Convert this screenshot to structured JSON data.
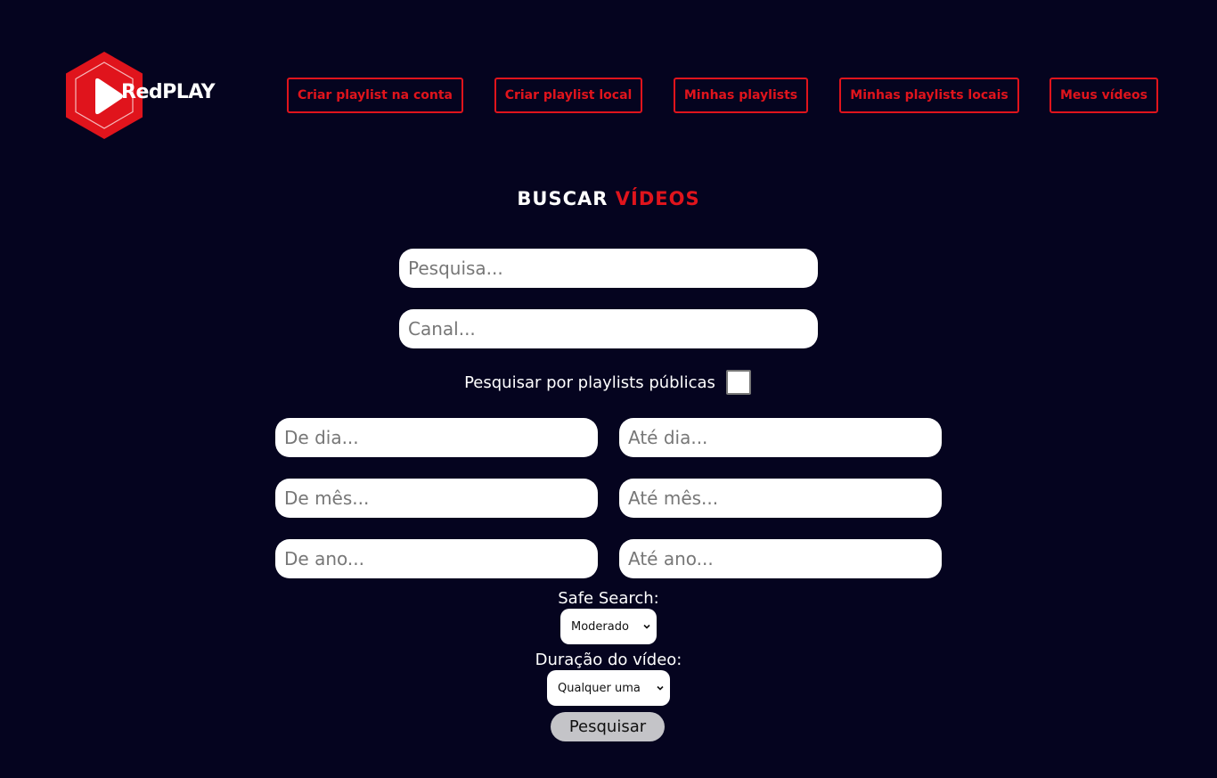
{
  "header": {
    "logo_text": "RedPLAY",
    "nav": [
      {
        "label": "Criar playlist na conta"
      },
      {
        "label": "Criar playlist local"
      },
      {
        "label": "Minhas playlists"
      },
      {
        "label": "Minhas playlists locais"
      },
      {
        "label": "Meus vídeos"
      }
    ]
  },
  "main": {
    "title_part1": "BUSCAR",
    "title_part2": "VÍDEOS",
    "search_placeholder": "Pesquisa...",
    "channel_placeholder": "Canal...",
    "public_playlists_label": "Pesquisar por playlists públicas",
    "public_playlists_checked": false,
    "from_day_placeholder": "De dia...",
    "to_day_placeholder": "Até dia...",
    "from_month_placeholder": "De mês...",
    "to_month_placeholder": "Até mês...",
    "from_year_placeholder": "De ano...",
    "to_year_placeholder": "Até ano...",
    "safe_search_label": "Safe Search:",
    "safe_search_value": "Moderado",
    "duration_label": "Duração do vídeo:",
    "duration_value": "Qualquer uma",
    "submit_label": "Pesquisar"
  },
  "colors": {
    "background": "#05041f",
    "accent": "#e0141c"
  },
  "icons": {
    "logo": "play-hexagon-icon",
    "select_arrow": "chevron-down-icon"
  }
}
